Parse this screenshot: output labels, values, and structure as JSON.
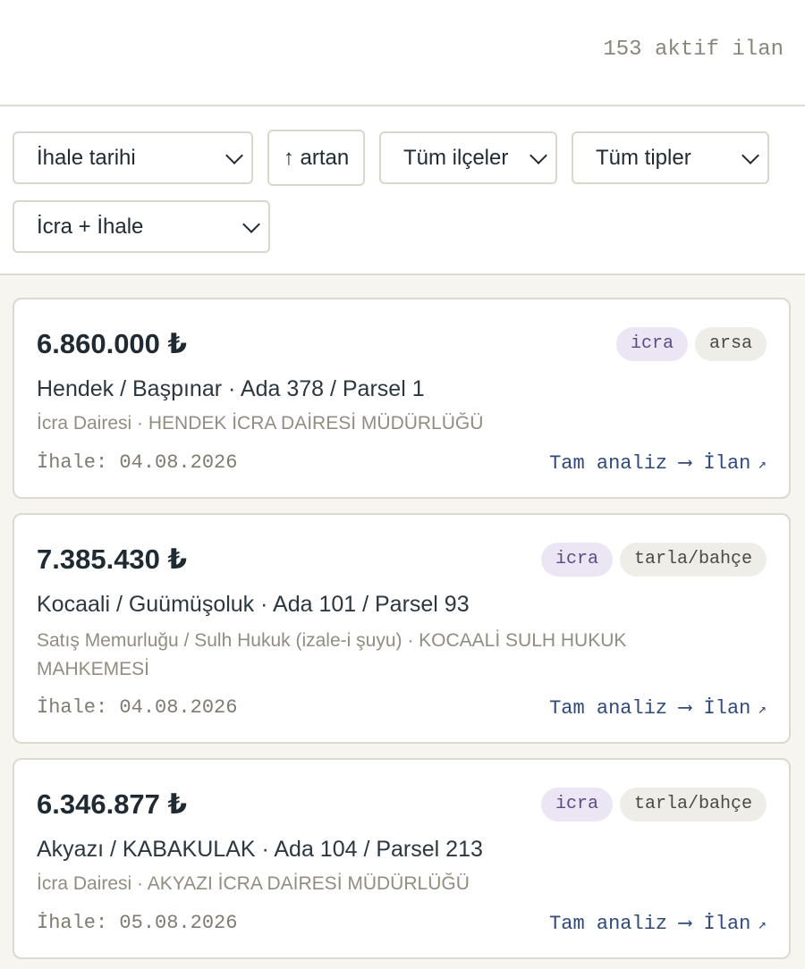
{
  "header": {
    "count_text": "153 aktif ilan"
  },
  "filters": {
    "sort_field": "İhale tarihi",
    "sort_direction": "↑ artan",
    "district": "Tüm ilçeler",
    "type": "Tüm tipler",
    "source": "İcra + İhale"
  },
  "listings": [
    {
      "price": "6.860.000 ₺",
      "tags": [
        "icra",
        "arsa"
      ],
      "location": "Hendek / Başpınar · Ada 378 / Parsel 1",
      "office": "İcra Dairesi · HENDEK İCRA DAİRESİ MÜDÜRLÜĞÜ",
      "date": "İhale: 04.08.2026",
      "analysis_link": "Tam analiz ⟶",
      "listing_link": "İlan",
      "ext_icon": "↗"
    },
    {
      "price": "7.385.430 ₺",
      "tags": [
        "icra",
        "tarla/bahçe"
      ],
      "location": "Kocaali / Guümüşoluk · Ada 101 / Parsel 93",
      "office": "Satış Memurluğu / Sulh Hukuk (izale-i şuyu) · KOCAALİ SULH HUKUK MAHKEMESİ",
      "date": "İhale: 04.08.2026",
      "analysis_link": "Tam analiz ⟶",
      "listing_link": "İlan",
      "ext_icon": "↗"
    },
    {
      "price": "6.346.877 ₺",
      "tags": [
        "icra",
        "tarla/bahçe"
      ],
      "location": "Akyazı / KABAKULAK · Ada 104 / Parsel 213",
      "office": "İcra Dairesi · AKYAZI İCRA DAİRESİ MÜDÜRLÜĞÜ",
      "date": "İhale: 05.08.2026",
      "analysis_link": "Tam analiz ⟶",
      "listing_link": "İlan",
      "ext_icon": "↗"
    }
  ]
}
